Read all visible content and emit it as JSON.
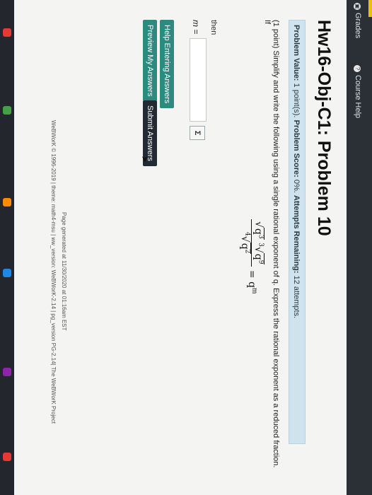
{
  "nav": {
    "grades": "Grades",
    "course_help": "Course Help"
  },
  "page": {
    "title": "Hw16-Obj-C1: Problem 10"
  },
  "info": {
    "problem_value_label": "Problem Value:",
    "problem_value": "1 point(s).",
    "score_label": "Problem Score:",
    "score": "0%.",
    "attempts_label": "Attempts Remaining:",
    "attempts": "12 attempts."
  },
  "problem": {
    "text": "(1 point) Simplify and write the following using a single rational exponent of q. Express the rational exponent as a reduced fraction. If",
    "then": "then",
    "m_label": "m =",
    "formula_rhs": "= q",
    "formula_rhs_exp": "m"
  },
  "buttons": {
    "help_entering": "Help Entering Answers",
    "preview": "Preview My Answers",
    "submit": "Submit Answers"
  },
  "input": {
    "value": "",
    "icon": "Σ"
  },
  "footer": {
    "generated": "Page generated at 11/30/2020 at 01:16am EST",
    "version": "WeBWorK © 1996-2019 | theme: math4-msu | ww_version: WeBWorK-2.14 | pg_version PG-2.14| The WeBWorK Project"
  },
  "colors": {
    "accent_green": "#2d8a7f",
    "info_bar": "#cfe3ec",
    "submit_dark": "#222a33"
  }
}
